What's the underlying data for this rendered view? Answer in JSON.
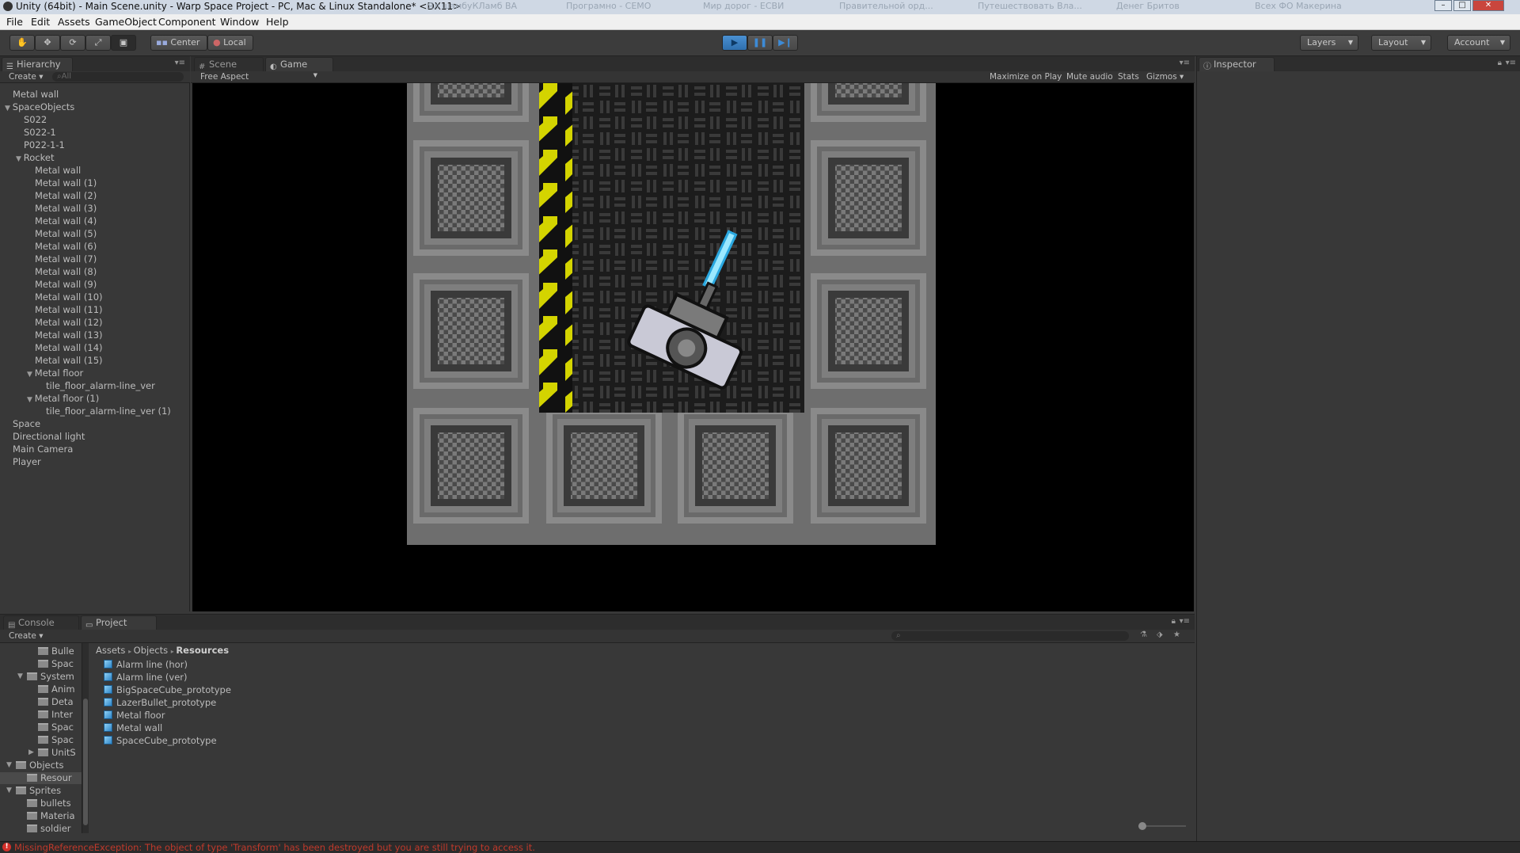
{
  "window": {
    "title": "Unity (64bit) - Main Scene.unity - Warp Space Project - PC, Mac & Linux Standalone* <DX11>",
    "background_tabs": [
      "Ял шамбуКЛамб ВА",
      "Програмно - СЕМО",
      "Мир дорог - ЕСВИ",
      "Правительной орд...",
      "Путешествовать Вла...",
      "Денег Бритов",
      "Всех ФО Макерина"
    ]
  },
  "menu": [
    "File",
    "Edit",
    "Assets",
    "GameObject",
    "Component",
    "Window",
    "Help"
  ],
  "toolbar": {
    "pivot": "Center",
    "space": "Local",
    "layers": "Layers",
    "layout": "Layout",
    "account": "Account",
    "play_icon": "play-icon",
    "pause_icon": "pause-icon",
    "step_icon": "step-icon",
    "accent": "#3d8bd6"
  },
  "hierarchy": {
    "tab": "Hierarchy",
    "create": "Create",
    "search_placeholder": "All",
    "items": [
      {
        "label": "Metal wall",
        "indent": 0,
        "expanded": null
      },
      {
        "label": "SpaceObjects",
        "indent": 0,
        "expanded": true
      },
      {
        "label": "S022",
        "indent": 1,
        "expanded": null
      },
      {
        "label": "S022-1",
        "indent": 1,
        "expanded": null
      },
      {
        "label": "P022-1-1",
        "indent": 1,
        "expanded": null
      },
      {
        "label": "Rocket",
        "indent": 1,
        "expanded": true
      },
      {
        "label": "Metal wall",
        "indent": 2,
        "expanded": null
      },
      {
        "label": "Metal wall (1)",
        "indent": 2,
        "expanded": null
      },
      {
        "label": "Metal wall (2)",
        "indent": 2,
        "expanded": null
      },
      {
        "label": "Metal wall (3)",
        "indent": 2,
        "expanded": null
      },
      {
        "label": "Metal wall (4)",
        "indent": 2,
        "expanded": null
      },
      {
        "label": "Metal wall (5)",
        "indent": 2,
        "expanded": null
      },
      {
        "label": "Metal wall (6)",
        "indent": 2,
        "expanded": null
      },
      {
        "label": "Metal wall (7)",
        "indent": 2,
        "expanded": null
      },
      {
        "label": "Metal wall (8)",
        "indent": 2,
        "expanded": null
      },
      {
        "label": "Metal wall (9)",
        "indent": 2,
        "expanded": null
      },
      {
        "label": "Metal wall (10)",
        "indent": 2,
        "expanded": null
      },
      {
        "label": "Metal wall (11)",
        "indent": 2,
        "expanded": null
      },
      {
        "label": "Metal wall (12)",
        "indent": 2,
        "expanded": null
      },
      {
        "label": "Metal wall (13)",
        "indent": 2,
        "expanded": null
      },
      {
        "label": "Metal wall (14)",
        "indent": 2,
        "expanded": null
      },
      {
        "label": "Metal wall (15)",
        "indent": 2,
        "expanded": null
      },
      {
        "label": "Metal floor",
        "indent": 2,
        "expanded": true
      },
      {
        "label": "tile_floor_alarm-line_ver",
        "indent": 3,
        "expanded": null
      },
      {
        "label": "Metal floor (1)",
        "indent": 2,
        "expanded": true
      },
      {
        "label": "tile_floor_alarm-line_ver (1)",
        "indent": 3,
        "expanded": null
      },
      {
        "label": "Space",
        "indent": 0,
        "expanded": null
      },
      {
        "label": "Directional light",
        "indent": 0,
        "expanded": null
      },
      {
        "label": "Main Camera",
        "indent": 0,
        "expanded": null
      },
      {
        "label": "Player",
        "indent": 0,
        "expanded": null
      }
    ]
  },
  "game_view": {
    "tabs": [
      "Scene",
      "Game"
    ],
    "aspect": "Free Aspect",
    "options": [
      "Maximize on Play",
      "Mute audio",
      "Stats",
      "Gizmos"
    ],
    "stripe_colors": [
      "#d4d400",
      "#111111"
    ]
  },
  "inspector": {
    "tab": "Inspector"
  },
  "bottom": {
    "tabs": [
      "Console",
      "Project"
    ],
    "create": "Create",
    "breadcrumb": [
      "Assets",
      "Objects",
      "Resources"
    ],
    "tree": [
      {
        "label": "Bulle",
        "indent": 2,
        "expanded": null
      },
      {
        "label": "Spac",
        "indent": 2,
        "expanded": null
      },
      {
        "label": "System",
        "indent": 1,
        "expanded": true
      },
      {
        "label": "Anim",
        "indent": 2,
        "expanded": null
      },
      {
        "label": "Deta",
        "indent": 2,
        "expanded": null
      },
      {
        "label": "Inter",
        "indent": 2,
        "expanded": null
      },
      {
        "label": "Spac",
        "indent": 2,
        "expanded": null
      },
      {
        "label": "Spac",
        "indent": 2,
        "expanded": null
      },
      {
        "label": "UnitS",
        "indent": 2,
        "expanded": false
      },
      {
        "label": "Objects",
        "indent": 0,
        "expanded": true
      },
      {
        "label": "Resour",
        "indent": 1,
        "expanded": null,
        "selected": true
      },
      {
        "label": "Sprites",
        "indent": 0,
        "expanded": true
      },
      {
        "label": "bullets",
        "indent": 1,
        "expanded": null
      },
      {
        "label": "Materia",
        "indent": 1,
        "expanded": null
      },
      {
        "label": "soldier",
        "indent": 1,
        "expanded": null
      }
    ],
    "assets": [
      "Alarm line (hor)",
      "Alarm line (ver)",
      "BigSpaceCube_prototype",
      "LazerBullet_prototype",
      "Metal floor",
      "Metal wall",
      "SpaceCube_prototype"
    ]
  },
  "status": {
    "message": "MissingReferenceException: The object of type 'Transform' has been destroyed but you are still trying to access it.",
    "color": "#c0392b"
  }
}
